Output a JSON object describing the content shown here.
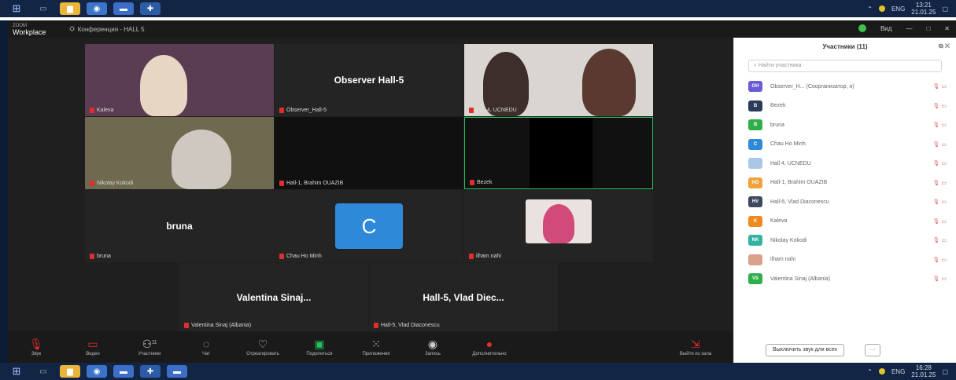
{
  "taskbar": {
    "clock_top": "13:21",
    "date_top": "21.01.25",
    "clock_bottom": "16:28",
    "date_bottom": "21.01.25",
    "lang": "ENG"
  },
  "app": {
    "brand_small": "ZOOM",
    "brand": "Workplace",
    "conference_title": "Конференция - HALL 5",
    "view_label": "Вид"
  },
  "tiles": [
    {
      "name": "Kaleva",
      "label": "",
      "kind": "video"
    },
    {
      "name": "Observer_Hall-5",
      "label": "Observer Hall-5",
      "kind": "label"
    },
    {
      "name": "Hall 4, UCNEDU",
      "label": "",
      "kind": "video"
    },
    {
      "name": "Nikolay Kokodi",
      "label": "",
      "kind": "video"
    },
    {
      "name": "Hall-1, Brahim OUAZIB",
      "label": "",
      "kind": "label"
    },
    {
      "name": "Bezek",
      "label": "",
      "kind": "label"
    },
    {
      "name": "bruna",
      "label": "bruna",
      "kind": "label"
    },
    {
      "name": "Chau Ho Minh",
      "label": "C",
      "kind": "avatar"
    },
    {
      "name": "ilham nahi",
      "label": "",
      "kind": "video"
    },
    {
      "name": "Valentina Sinaj (Albania)",
      "label": "Valentina Sinaj...",
      "kind": "label"
    },
    {
      "name": "Hall-5, Vlad Diaconescu",
      "label": "Hall-5, Vlad Diec...",
      "kind": "label"
    }
  ],
  "toolbar": {
    "audio": "Звук",
    "video": "Видео",
    "participants": "Участники",
    "participants_count": "11",
    "chat": "Чат",
    "react": "Отреагировать",
    "share": "Поделиться",
    "apps": "Приложения",
    "record": "Запись",
    "more": "Дополнительно",
    "leave": "Выйти из зала"
  },
  "panel": {
    "title": "Участники (11)",
    "search_placeholder": "Найти участника",
    "participants": [
      {
        "initials": "OH",
        "name": "Observer_H... (Соорганизатор, я)",
        "color": "#6b5bd6"
      },
      {
        "initials": "B",
        "name": "Bezek",
        "color": "#2a3a58"
      },
      {
        "initials": "B",
        "name": "bruna",
        "color": "#2fae4a"
      },
      {
        "initials": "C",
        "name": "Chau Ho Minh",
        "color": "#2e8ad8"
      },
      {
        "initials": "",
        "name": "Hall 4, UCNEDU",
        "color": "#a9c8e8"
      },
      {
        "initials": "HO",
        "name": "Hall-1, Brahim OUAZIB",
        "color": "#f0a23a"
      },
      {
        "initials": "HV",
        "name": "Hall-5, Vlad Diaconescu",
        "color": "#3f4a60"
      },
      {
        "initials": "K",
        "name": "Kaleva",
        "color": "#f08a1f"
      },
      {
        "initials": "NK",
        "name": "Nikolay Kokodi",
        "color": "#35b3a0"
      },
      {
        "initials": "",
        "name": "ilham nahi",
        "color": "#d9a08a"
      },
      {
        "initials": "VS",
        "name": "Valentina Sinaj (Albania)",
        "color": "#2fae4a"
      }
    ],
    "mute_all": "Выключить звук для всех",
    "more": "···"
  },
  "colors": {
    "accent": "#2e8ad8",
    "mic_off": "#e02d2d",
    "speaker_border": "#23c45a"
  }
}
